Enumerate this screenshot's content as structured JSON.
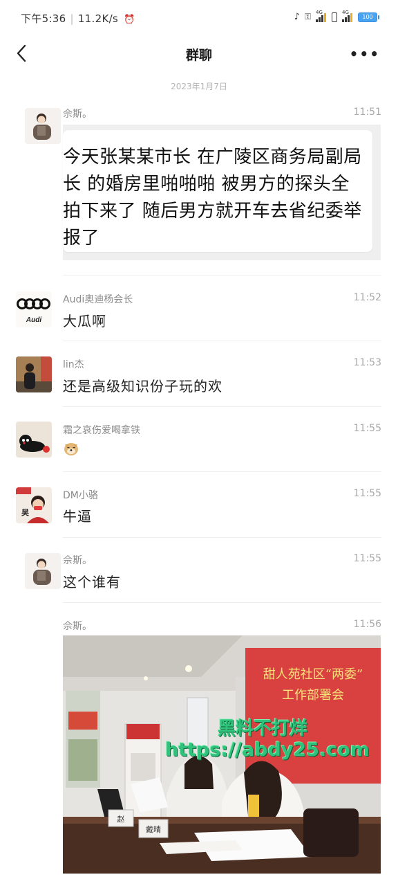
{
  "status_bar": {
    "time": "下午5:36",
    "network_speed": "11.2K/s",
    "battery_level": "100"
  },
  "header": {
    "title": "群聊",
    "more_label": "•••"
  },
  "date_divider": "2023年1月7日",
  "messages": [
    {
      "sender": "佘斯。",
      "time": "11:51",
      "text": "今天张某某市长 在广陵区商务局副局长 的婚房里啪啪啪 被男方的探头全拍下来了 随后男方就开车去省纪委举报了"
    },
    {
      "sender": "Audi奥迪杨会长",
      "time": "11:52",
      "text": "大瓜啊"
    },
    {
      "sender": "lin杰",
      "time": "11:53",
      "text": "还是高级知识份子玩的欢"
    },
    {
      "sender": "霜之哀伤爱喝拿铁",
      "time": "11:55",
      "text": ""
    },
    {
      "sender": "DM小骆",
      "time": "11:55",
      "text": "牛逼"
    },
    {
      "sender": "佘斯。",
      "time": "11:55",
      "text": "这个谁有"
    },
    {
      "sender": "佘斯。",
      "time": "11:56",
      "text": ""
    }
  ],
  "avatar_labels": {
    "audi": "Audi",
    "dm": "吴"
  },
  "photo": {
    "banner_line1": "甜人苑社区“两委”",
    "banner_line2": "工作部署会",
    "nameplate_left": "赵",
    "nameplate_right": "戴晴",
    "watermark_line1": "黑料不打烊",
    "watermark_line2": "https://abdy25.com"
  },
  "colors": {
    "accent_battery": "#4aa3f0",
    "banner_red": "#d8413f",
    "watermark_green": "#2fc27a"
  }
}
